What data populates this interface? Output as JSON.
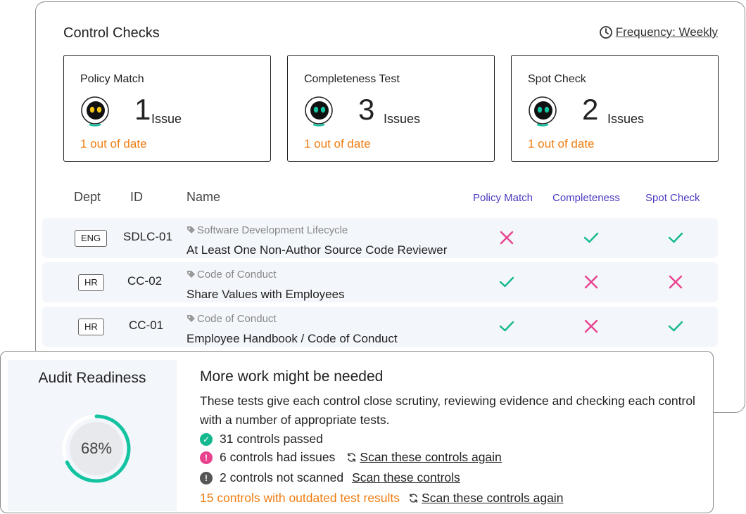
{
  "control_checks": {
    "title": "Control Checks",
    "frequency": "Frequency: Weekly",
    "cards": [
      {
        "title": "Policy Match",
        "count": "1",
        "unit": "Issue",
        "status": "1 out of date",
        "robot_eye_color": "#f5c518"
      },
      {
        "title": "Completeness Test",
        "count": "3",
        "unit": "Issues",
        "status": "1 out of date",
        "robot_eye_color": "#13c3a2"
      },
      {
        "title": "Spot Check",
        "count": "2",
        "unit": "Issues",
        "status": "1 out of date",
        "robot_eye_color": "#13c3a2"
      }
    ]
  },
  "table": {
    "headers": {
      "dept": "Dept",
      "id": "ID",
      "name": "Name",
      "policy": "Policy Match",
      "completeness": "Completeness",
      "spot": "Spot Check"
    },
    "rows": [
      {
        "dept": "ENG",
        "id": "SDLC-01",
        "category": "Software Development Lifecycle",
        "name": "At Least One Non-Author Source Code Reviewer",
        "policy": "fail",
        "completeness": "pass",
        "spot": "pass"
      },
      {
        "dept": "HR",
        "id": "CC-02",
        "category": "Code of Conduct",
        "name": "Share Values with Employees",
        "policy": "pass",
        "completeness": "fail",
        "spot": "fail"
      },
      {
        "dept": "HR",
        "id": "CC-01",
        "category": "Code of Conduct",
        "name": "Employee Handbook / Code of Conduct",
        "policy": "pass",
        "completeness": "fail",
        "spot": "pass"
      }
    ]
  },
  "audit": {
    "title": "Audit Readiness",
    "percent_label": "68%",
    "progress": 0.68,
    "heading": "More work might be needed",
    "description": "These tests give each control close scrutiny, reviewing evidence and checking each control with a number of appropriate tests.",
    "passed": "31 controls passed",
    "issues": "6 controls had issues",
    "issues_link": "Scan these controls again",
    "not_scanned": "2 controls not scanned",
    "not_scanned_link": "Scan these controls",
    "outdated": "15 controls with outdated test results",
    "outdated_link": "Scan these controls again"
  },
  "colors": {
    "pass": "#13b88f",
    "fail": "#e8428f",
    "accent": "#4a3bbf",
    "warning": "#f07d12",
    "ring": "#13c3a2"
  }
}
